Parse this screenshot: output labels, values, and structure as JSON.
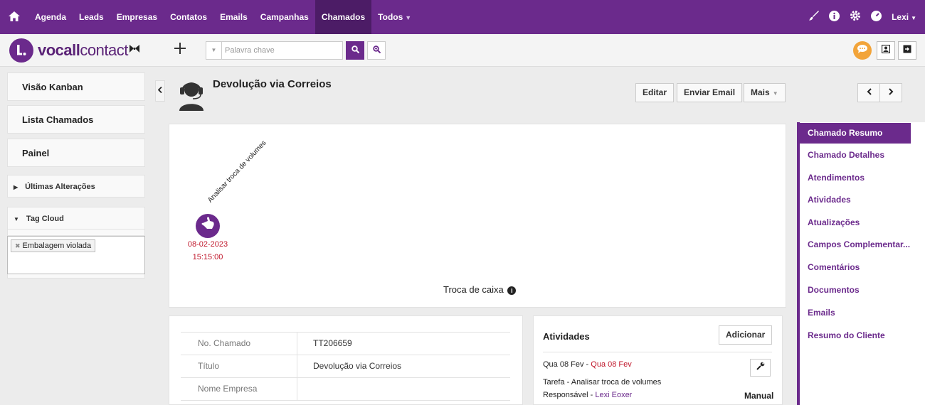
{
  "topnav": {
    "items": [
      {
        "label": "Agenda"
      },
      {
        "label": "Leads"
      },
      {
        "label": "Empresas"
      },
      {
        "label": "Contatos"
      },
      {
        "label": "Emails"
      },
      {
        "label": "Campanhas"
      },
      {
        "label": "Chamados",
        "active": true
      },
      {
        "label": "Todos"
      }
    ],
    "user": "Lexi",
    "icons": [
      "home-icon",
      "brush-icon",
      "info-icon",
      "gear-icon",
      "gauge-icon"
    ]
  },
  "brand": {
    "part_a": "vocall",
    "part_b": "contact"
  },
  "search": {
    "placeholder": "Palavra chave"
  },
  "sidebar": {
    "buttons": [
      {
        "label": "Visão Kanban"
      },
      {
        "label": "Lista Chamados"
      },
      {
        "label": "Painel"
      }
    ],
    "sections": [
      {
        "label": "Últimas Alterações",
        "expanded": false
      },
      {
        "label": "Tag Cloud",
        "expanded": true
      }
    ],
    "tags": [
      {
        "label": "Embalagem violada"
      }
    ]
  },
  "record": {
    "title": "Devolução via Correios",
    "actions": {
      "edit": "Editar",
      "send_email": "Enviar Email",
      "more": "Mais"
    }
  },
  "timeline": {
    "event_label": "Analisar troca de volumes",
    "date": "08-02-2023",
    "time": "15:15:00",
    "caption": "Troca de caixa",
    "accent_color": "#6b2a8c",
    "date_color": "#c0172b"
  },
  "details": {
    "rows": [
      {
        "label": "No. Chamado",
        "value": "TT206659"
      },
      {
        "label": "Título",
        "value": "Devolução via Correios"
      },
      {
        "label": "Nome Empresa",
        "value": ""
      }
    ]
  },
  "activities": {
    "title": "Atividades",
    "add_label": "Adicionar",
    "item": {
      "date_prefix": "Qua 08 Fev",
      "date_sep": " - ",
      "date_due": "Qua 08 Fev",
      "type_line": "Tarefa - Analisar troca de volumes",
      "resp_label": "Responsável - ",
      "resp_name": "Lexi Eoxer",
      "mode": "Manual"
    }
  },
  "rightnav": {
    "items": [
      {
        "label": "Chamado Resumo",
        "active": true
      },
      {
        "label": "Chamado Detalhes"
      },
      {
        "label": "Atendimentos"
      },
      {
        "label": "Atividades"
      },
      {
        "label": "Atualizações"
      },
      {
        "label": "Campos Complementar..."
      },
      {
        "label": "Comentários"
      },
      {
        "label": "Documentos"
      },
      {
        "label": "Emails"
      },
      {
        "label": "Resumo do Cliente"
      }
    ]
  },
  "theme": {
    "primary": "#6b2a8c",
    "nav_active": "#4c1c66",
    "accent_orange": "#f2a43a"
  }
}
